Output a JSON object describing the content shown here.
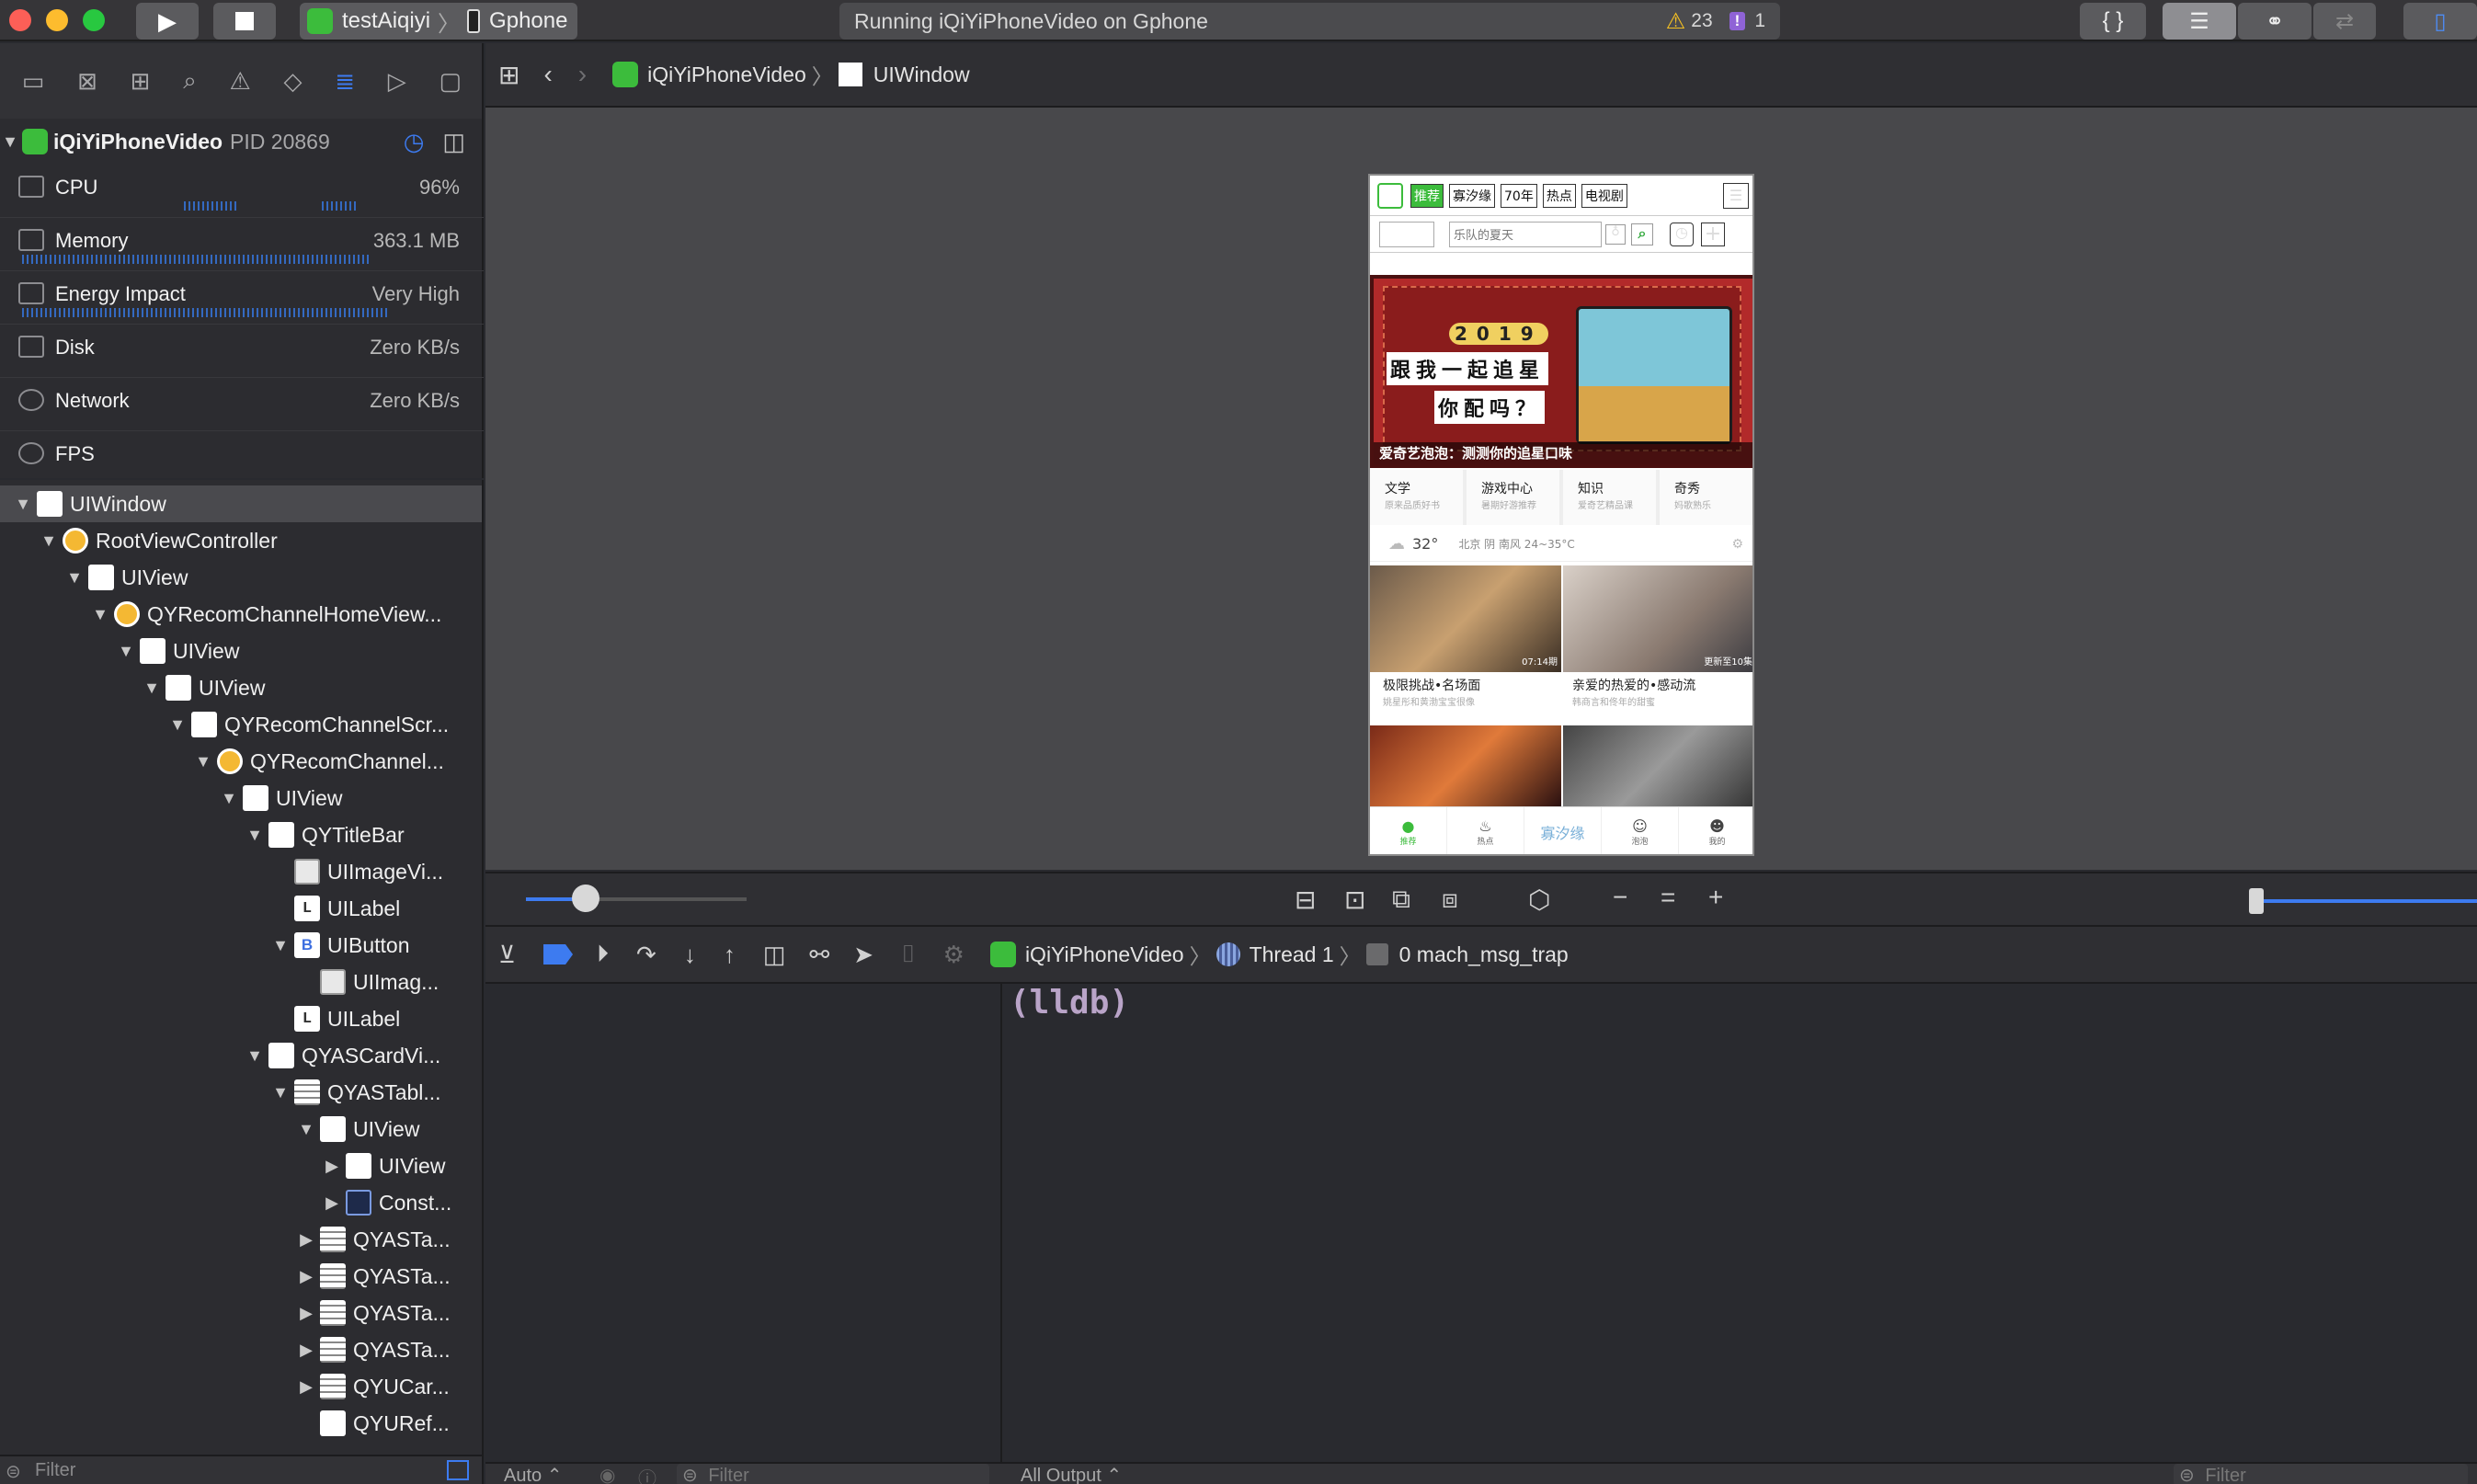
{
  "toolbar": {
    "scheme_name": "testAiqiyi",
    "device_name": "Gphone",
    "status_text": "Running iQiYiPhoneVideo on Gphone",
    "warning_count": "23",
    "issue_count": "1",
    "braces_label": "{ }"
  },
  "debug_navigator": {
    "process_name": "iQiYiPhoneVideo",
    "pid_label": "PID 20869",
    "gauges": [
      {
        "name": "CPU",
        "value": "96%"
      },
      {
        "name": "Memory",
        "value": "363.1 MB"
      },
      {
        "name": "Energy Impact",
        "value": "Very High"
      },
      {
        "name": "Disk",
        "value": "Zero KB/s"
      },
      {
        "name": "Network",
        "value": "Zero KB/s"
      },
      {
        "name": "FPS",
        "value": ""
      }
    ]
  },
  "view_tree": [
    {
      "label": "UIWindow",
      "expanded": true,
      "kind": "view"
    },
    {
      "label": "RootViewController",
      "expanded": true,
      "kind": "vc"
    },
    {
      "label": "UIView",
      "expanded": true,
      "kind": "view"
    },
    {
      "label": "QYRecomChannelHomeView...",
      "expanded": true,
      "kind": "vc"
    },
    {
      "label": "UIView",
      "expanded": true,
      "kind": "view"
    },
    {
      "label": "UIView",
      "expanded": true,
      "kind": "view"
    },
    {
      "label": "QYRecomChannelScr...",
      "expanded": true,
      "kind": "view"
    },
    {
      "label": "QYRecomChannel...",
      "expanded": true,
      "kind": "vc"
    },
    {
      "label": "UIView",
      "expanded": true,
      "kind": "view"
    },
    {
      "label": "QYTitleBar",
      "expanded": true,
      "kind": "view"
    },
    {
      "label": "UIImageVi...",
      "expanded": null,
      "kind": "image"
    },
    {
      "label": "UILabel",
      "expanded": null,
      "kind": "label",
      "glyph": "L"
    },
    {
      "label": "UIButton",
      "expanded": true,
      "kind": "button",
      "glyph": "B"
    },
    {
      "label": "UIImag...",
      "expanded": null,
      "kind": "image"
    },
    {
      "label": "UILabel",
      "expanded": null,
      "kind": "label",
      "glyph": "L"
    },
    {
      "label": "QYASCardVi...",
      "expanded": true,
      "kind": "view"
    },
    {
      "label": "QYASTabl...",
      "expanded": true,
      "kind": "table"
    },
    {
      "label": "UIView",
      "expanded": true,
      "kind": "view"
    },
    {
      "label": "UIView",
      "expanded": false,
      "kind": "view"
    },
    {
      "label": "Const...",
      "expanded": false,
      "kind": "constraint"
    },
    {
      "label": "QYASTa...",
      "expanded": false,
      "kind": "table"
    },
    {
      "label": "QYASTa...",
      "expanded": false,
      "kind": "table"
    },
    {
      "label": "QYASTa...",
      "expanded": false,
      "kind": "table"
    },
    {
      "label": "QYASTa...",
      "expanded": false,
      "kind": "table"
    },
    {
      "label": "QYUCar...",
      "expanded": false,
      "kind": "table"
    },
    {
      "label": "QYURef...",
      "expanded": null,
      "kind": "view"
    }
  ],
  "left_filter": {
    "placeholder": "Filter"
  },
  "jump_bar": {
    "app": "iQiYiPhoneVideo",
    "item": "UIWindow"
  },
  "phone": {
    "tabs": [
      "推荐",
      "寡汐缘",
      "70年",
      "热点",
      "电视剧"
    ],
    "search_placeholder": "乐队的夏天",
    "banner_year": "2019",
    "banner_line1": "跟我一起追星",
    "banner_line2": "你配吗？",
    "banner_caption": "爱奇艺泡泡：测测你的追星口味",
    "categories": [
      {
        "title": "文学",
        "sub": "原来品质好书"
      },
      {
        "title": "游戏中心",
        "sub": "暑期好游推荐"
      },
      {
        "title": "知识",
        "sub": "爱奇艺精品课"
      },
      {
        "title": "奇秀",
        "sub": "妈歌熟乐"
      }
    ],
    "weather": {
      "temp": "32°",
      "text": "北京 阴 南风 24~35°C"
    },
    "videos": [
      {
        "title": "极限挑战•名场面",
        "sub": "姚星彤和黄渤宝宝很像",
        "badge": "07:14期"
      },
      {
        "title": "亲爱的热爱的•感动流",
        "sub": "韩商言和佟年的甜蜜",
        "badge": "更新至10集"
      }
    ],
    "bottom_tabs": [
      "推荐",
      "热点",
      "寡汐缘",
      "泡泡",
      "我的"
    ]
  },
  "exec_bar": {
    "app": "iQiYiPhoneVideo",
    "thread": "Thread 1",
    "frame": "0 mach_msg_trap"
  },
  "console": {
    "prompt": "(lldb)"
  },
  "bottom_bar": {
    "auto_label": "Auto ⌃",
    "var_filter": "Filter",
    "output_label": "All Output ⌃",
    "console_filter": "Filter"
  }
}
